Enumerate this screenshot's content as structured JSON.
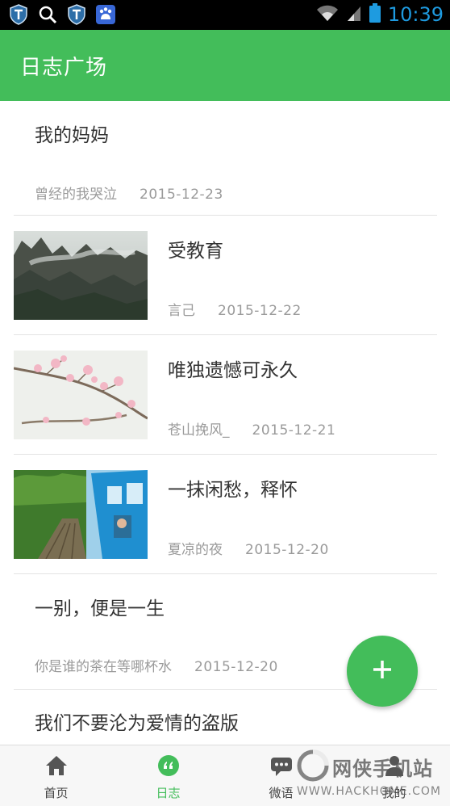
{
  "status_bar": {
    "time": "10:39"
  },
  "app_bar": {
    "title": "日志广场"
  },
  "feed": [
    {
      "title": "我的妈妈",
      "author": "曾经的我哭泣",
      "date": "2015-12-23",
      "thumbnail": null
    },
    {
      "title": "受教育",
      "author": "言己",
      "date": "2015-12-22",
      "thumbnail": "misty-mountain"
    },
    {
      "title": "唯独遗憾可永久",
      "author": "苍山挽风_",
      "date": "2015-12-21",
      "thumbnail": "cherry-blossom"
    },
    {
      "title": " 一抹闲愁，释怀",
      "author": "夏凉的夜",
      "date": "2015-12-20",
      "thumbnail": "blue-train"
    },
    {
      "title": "一别，便是一生",
      "author": "你是谁的茶在等哪杯水",
      "date": "2015-12-20",
      "thumbnail": null
    },
    {
      "title": "我们不要沦为爱情的盗版",
      "author": "",
      "date": "",
      "thumbnail": null
    }
  ],
  "fab": {
    "label": "+",
    "icon": "plus-icon"
  },
  "bottom_nav": [
    {
      "label": "首页",
      "icon": "home-icon",
      "active": false
    },
    {
      "label": "日志",
      "icon": "quote-icon",
      "active": true
    },
    {
      "label": "微语",
      "icon": "chat-icon",
      "active": false
    },
    {
      "label": "我的",
      "icon": "person-icon",
      "active": false
    }
  ],
  "watermark": {
    "text": "网侠手机站",
    "url": "WWW.HACKHOME.COM"
  },
  "colors": {
    "accent": "#43bd5a",
    "clock": "#1e9be0",
    "status_bar": "#000000"
  }
}
